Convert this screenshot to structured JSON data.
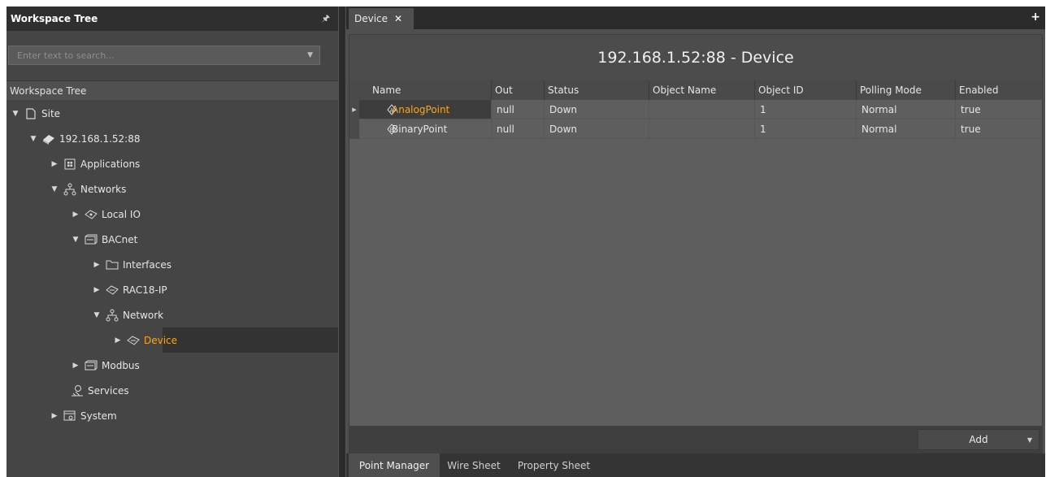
{
  "left_panel": {
    "title": "Workspace Tree",
    "pin_icon": "pin-icon",
    "search": {
      "placeholder": "Enter text to search..."
    },
    "tree_header": "Workspace Tree",
    "nodes": [
      {
        "label": "Site",
        "icon": "file-icon",
        "expanded": true
      },
      {
        "label": "192.168.1.52:88",
        "icon": "device-icon",
        "expanded": true
      },
      {
        "label": "Applications",
        "icon": "applications-icon",
        "expanded": false
      },
      {
        "label": "Networks",
        "icon": "network-icon",
        "expanded": true
      },
      {
        "label": "Local IO",
        "icon": "io-icon",
        "expanded": false
      },
      {
        "label": "BACnet",
        "icon": "bacnet-icon",
        "expanded": true
      },
      {
        "label": "Interfaces",
        "icon": "folder-icon",
        "expanded": false
      },
      {
        "label": "RAC18-IP",
        "icon": "device-icon",
        "expanded": false
      },
      {
        "label": "Network",
        "icon": "network-icon",
        "expanded": true
      },
      {
        "label": "Device",
        "icon": "device-icon",
        "expanded": false,
        "selected": true
      },
      {
        "label": "Modbus",
        "icon": "modbus-icon",
        "expanded": false
      },
      {
        "label": "Services",
        "icon": "services-icon"
      },
      {
        "label": "System",
        "icon": "system-icon",
        "expanded": false
      }
    ]
  },
  "tabs": {
    "open": [
      {
        "label": "Device",
        "close": "✕"
      }
    ],
    "add": "+"
  },
  "main": {
    "title": "192.168.1.52:88 - Device",
    "columns": [
      "Name",
      "Out",
      "Status",
      "Object Name",
      "Object ID",
      "Polling Mode",
      "Enabled"
    ],
    "rows": [
      {
        "letter": "A",
        "name": "AnalogPoint",
        "out": "null",
        "status": "Down",
        "object_name": "",
        "object_id": "1",
        "polling_mode": "Normal",
        "enabled": "true"
      },
      {
        "letter": "B",
        "name": "BinaryPoint",
        "out": "null",
        "status": "Down",
        "object_name": "",
        "object_id": "1",
        "polling_mode": "Normal",
        "enabled": "true"
      }
    ],
    "add_button": "Add"
  },
  "bottom_tabs": [
    "Point Manager",
    "Wire Sheet",
    "Property Sheet"
  ],
  "colors": {
    "accent": "#f5a623",
    "panel": "#454545",
    "header": "#2f2f2f"
  }
}
